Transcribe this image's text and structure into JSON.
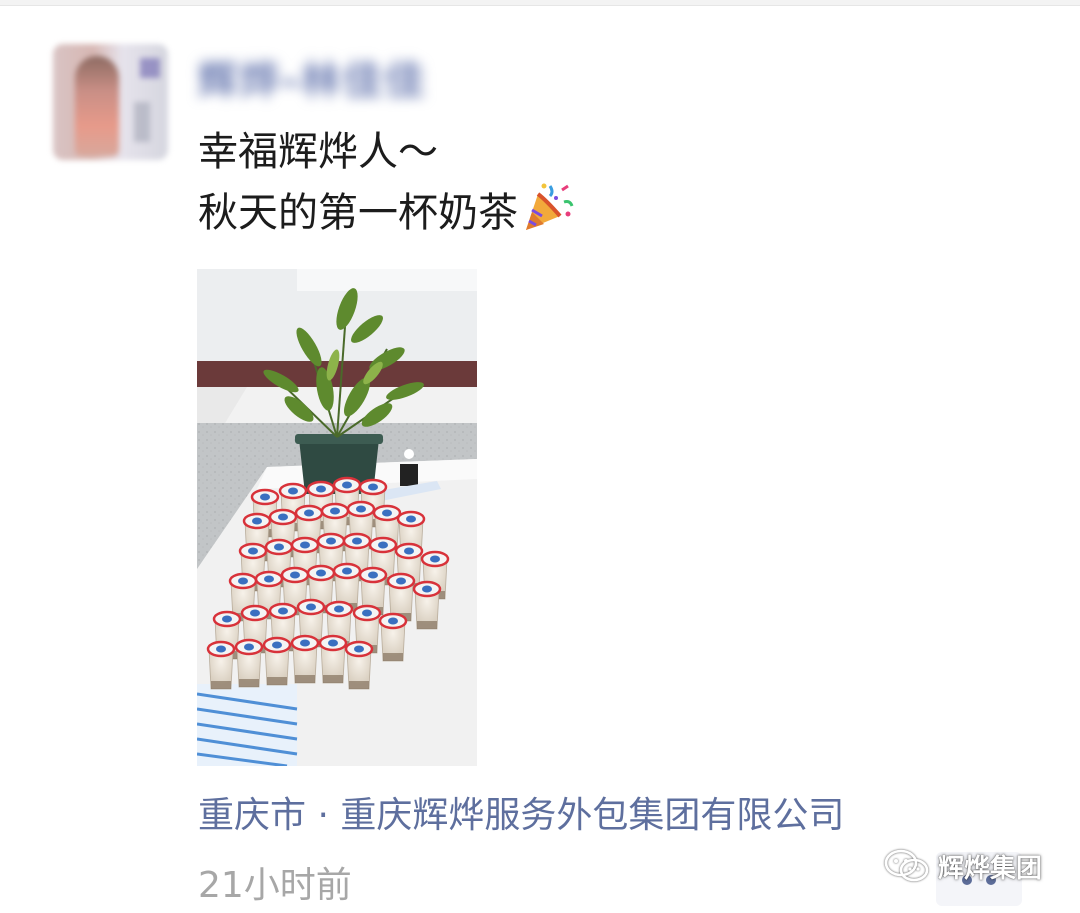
{
  "post": {
    "username": "辉烨-林佳佳",
    "text_line1": "幸福辉烨人～",
    "text_line2": "秋天的第一杯奶茶",
    "emoji": "party-popper-icon",
    "location": "重庆市 · 重庆辉烨服务外包集团有限公司",
    "time_ago": "21小时前"
  },
  "watermark": {
    "text": "辉烨集团",
    "icon": "wechat-icon"
  },
  "colors": {
    "link": "#5e6f9e",
    "timestamp": "#a7a7a7",
    "text": "#1c1c1c"
  }
}
